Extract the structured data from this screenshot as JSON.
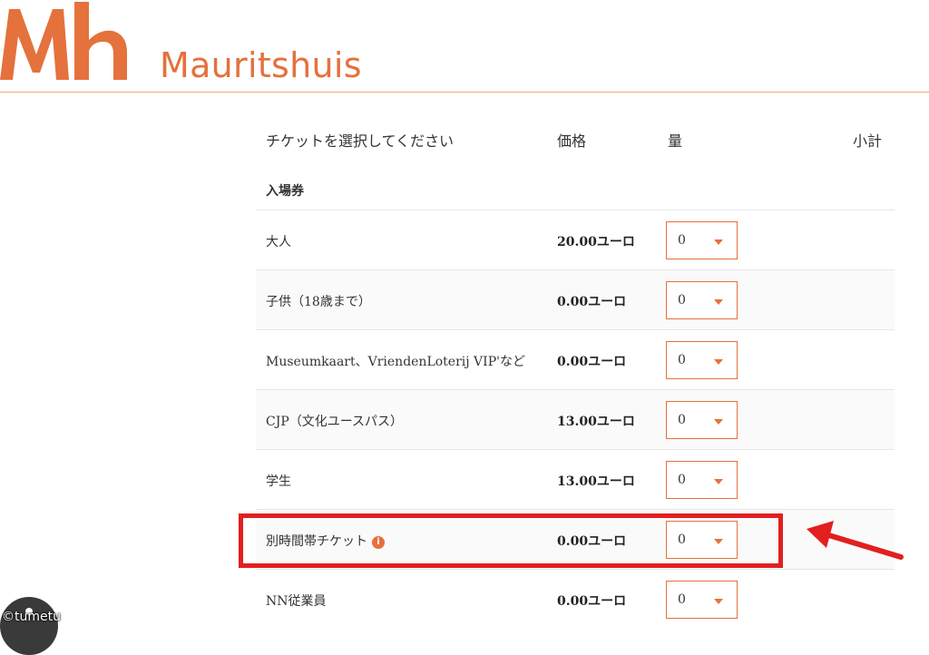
{
  "header": {
    "brand_name": "Mauritshuis",
    "accent_color": "#e5713d"
  },
  "table": {
    "columns": {
      "ticket": "チケットを選択してください",
      "price": "価格",
      "quantity": "量",
      "subtotal": "小計"
    },
    "section_title": "入場券",
    "rows": [
      {
        "name": "大人",
        "price": "20.00ユーロ",
        "quantity": "0"
      },
      {
        "name": "子供（18歳まで）",
        "price": "0.00ユーロ",
        "quantity": "0"
      },
      {
        "name": "Museumkaart、VriendenLoterij VIP'など",
        "price": "0.00ユーロ",
        "quantity": "0"
      },
      {
        "name": "CJP（文化ユースパス）",
        "price": "13.00ユーロ",
        "quantity": "0"
      },
      {
        "name": "学生",
        "price": "13.00ユーロ",
        "quantity": "0"
      },
      {
        "name": "別時間帯チケット",
        "price": "0.00ユーロ",
        "quantity": "0",
        "info_icon": "info-icon"
      },
      {
        "name": "NN従業員",
        "price": "0.00ユーロ",
        "quantity": "0"
      }
    ]
  },
  "annotation": {
    "highlight_color": "#e21f1f",
    "highlighted_row": "別時間帯チケット"
  },
  "watermark": {
    "text": "©tumetu"
  }
}
